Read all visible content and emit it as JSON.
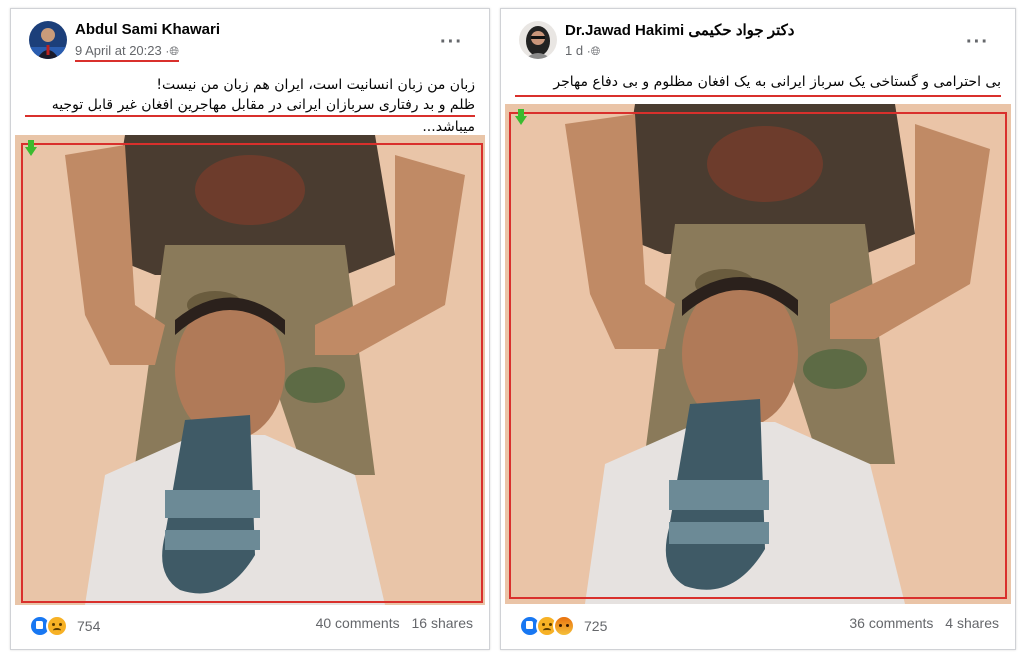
{
  "posts": [
    {
      "author": "Abdul Sami Khawari",
      "timestamp": "9 April at 20:23",
      "visibility_icon": "globe-icon",
      "text_lines": [
        "زبان من زبان انسانیت است، ایران هم زبان من نیست!",
        "ظلم و بد رفتاری سربازان ایرانی در مقابل مهاجرین افغان غیر قابل توجیه",
        "میباشد..."
      ],
      "reaction_count": "754",
      "comments": "40 comments",
      "shares": "16 shares",
      "reactions": [
        "like",
        "sad"
      ]
    },
    {
      "author": "Dr.Jawad Hakimi دکتر جواد حکیمی",
      "timestamp": "1 d",
      "visibility_icon": "globe-icon",
      "text_lines": [
        "بی احترامی و گستاخی یک سرباز ایرانی به یک افغان مظلوم و بی دفاع مهاجر"
      ],
      "reaction_count": "725",
      "comments": "36 comments",
      "shares": "4 shares",
      "reactions": [
        "like",
        "sad",
        "angry"
      ]
    }
  ],
  "colors": {
    "highlight": "#d9302c",
    "arrow": "#3bbb2f",
    "like": "#1877f2"
  }
}
